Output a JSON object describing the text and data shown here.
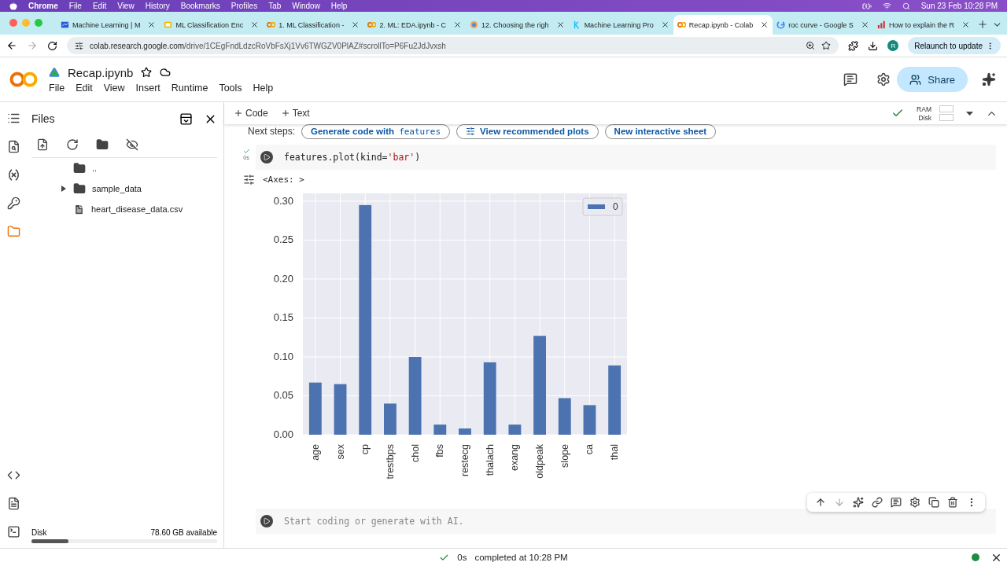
{
  "menubar": {
    "app": "Chrome",
    "items": [
      "File",
      "Edit",
      "View",
      "History",
      "Bookmarks",
      "Profiles",
      "Tab",
      "Window",
      "Help"
    ],
    "clock": "Sun 23 Feb 10:28 PM"
  },
  "tabs": [
    {
      "title": "Machine Learning | M",
      "kind": "chart",
      "selected": false
    },
    {
      "title": "ML Classification Enc",
      "kind": "slides",
      "selected": false
    },
    {
      "title": "1. ML Classification -",
      "kind": "colab",
      "selected": false
    },
    {
      "title": "2. ML: EDA.ipynb - C",
      "kind": "colab",
      "selected": false
    },
    {
      "title": "12. Choosing the righ",
      "kind": "globe",
      "selected": false
    },
    {
      "title": "Machine Learning Pro",
      "kind": "kaggle",
      "selected": false
    },
    {
      "title": "Recap.ipynb - Colab",
      "kind": "colab",
      "selected": true
    },
    {
      "title": "roc curve - Google S",
      "kind": "google",
      "selected": false
    },
    {
      "title": "How to explain the R",
      "kind": "bars",
      "selected": false
    }
  ],
  "address": {
    "host": "colab.research.google.com",
    "path": "/drive/1CEgFndLdzcRoVbFsXj1Vv6TWGZV0PlAZ#scrollTo=P6Fu2JdJvxsh"
  },
  "profile": "R",
  "relaunch": "Relaunch to update",
  "notebook": {
    "title": "Recap.ipynb",
    "menu": [
      "File",
      "Edit",
      "View",
      "Insert",
      "Runtime",
      "Tools",
      "Help"
    ],
    "share": "Share"
  },
  "toolbar": {
    "add": [
      "Code",
      "Text"
    ],
    "ram": "RAM",
    "disk": "Disk"
  },
  "sidebar": {
    "title": "Files",
    "items": [
      {
        "name": "..",
        "kind": "parent"
      },
      {
        "name": "sample_data",
        "kind": "folder",
        "expanded": false
      },
      {
        "name": "heart_disease_data.csv",
        "kind": "file"
      }
    ],
    "disk": {
      "label": "Disk",
      "available": "78.60 GB available",
      "level": 0.2
    }
  },
  "next_steps": {
    "label": "Next steps:",
    "chips": [
      {
        "text": "Generate code with ",
        "code": "features",
        "kind": "code"
      },
      {
        "text": "View recommended plots",
        "kind": "plots"
      },
      {
        "text": "New interactive sheet",
        "kind": "sheet"
      }
    ]
  },
  "cells": [
    {
      "kind": "code",
      "code": "features.plot(kind='bar')",
      "time": "0s",
      "ran": true,
      "output": "<Axes: >",
      "chart_data": {
        "type": "bar",
        "categories": [
          "age",
          "sex",
          "cp",
          "trestbps",
          "chol",
          "fbs",
          "restecg",
          "thalach",
          "exang",
          "oldpeak",
          "slope",
          "ca",
          "thal"
        ],
        "series": [
          {
            "name": "0",
            "color": "#4c72b0",
            "values": [
              0.067,
              0.065,
              0.295,
              0.04,
              0.1,
              0.013,
              0.008,
              0.093,
              0.013,
              0.127,
              0.047,
              0.038,
              0.089
            ]
          }
        ],
        "ylim": [
          0,
          0.31
        ],
        "grid": true,
        "yticks": [
          {
            "value": 0,
            "label": "0.00"
          },
          {
            "value": 0.05,
            "label": "0.05"
          },
          {
            "value": 0.1,
            "label": "0.10"
          },
          {
            "value": 0.15,
            "label": "0.15"
          },
          {
            "value": 0.2,
            "label": "0.20"
          },
          {
            "value": 0.25,
            "label": "0.25"
          },
          {
            "value": 0.3,
            "label": "0.30"
          }
        ]
      }
    },
    {
      "kind": "empty",
      "placeholder": "Start coding or generate with AI."
    }
  ],
  "status_bar": {
    "time": "0s",
    "message": "completed at 10:28 PM"
  }
}
